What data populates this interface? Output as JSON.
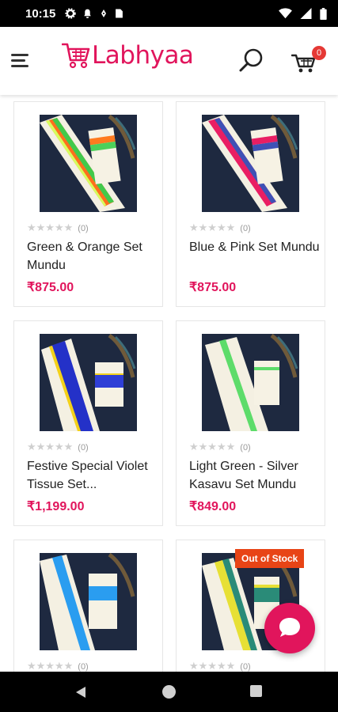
{
  "status_bar": {
    "time": "10:15",
    "left_icons": [
      "settings-icon",
      "notification-bell-icon",
      "location-icon",
      "sim-card-icon"
    ],
    "right_icons": [
      "wifi-icon",
      "signal-icon",
      "battery-icon"
    ]
  },
  "header": {
    "logo_text": "Labhyaa",
    "cart_count": "0",
    "brand_color": "#e1155c"
  },
  "products": [
    {
      "title": "Green & Orange Set Mundu",
      "price": "₹875.00",
      "rating_count": "(0)",
      "stars": "★★★★★",
      "out_of_stock": false
    },
    {
      "title": "Blue & Pink Set Mundu",
      "price": "₹875.00",
      "rating_count": "(0)",
      "stars": "★★★★★",
      "out_of_stock": false
    },
    {
      "title": "Festive Special Violet Tissue Set...",
      "price": "₹1,199.00",
      "rating_count": "(0)",
      "stars": "★★★★★",
      "out_of_stock": false
    },
    {
      "title": "Light Green - Silver Kasavu Set Mundu",
      "price": "₹849.00",
      "rating_count": "(0)",
      "stars": "★★★★★",
      "out_of_stock": false
    },
    {
      "title": "",
      "price": "",
      "rating_count": "(0)",
      "stars": "★★★★★",
      "out_of_stock": false
    },
    {
      "title": "",
      "price": "",
      "rating_count": "(0)",
      "stars": "★★★★★",
      "out_of_stock": true,
      "badge": "Out of Stock"
    }
  ]
}
